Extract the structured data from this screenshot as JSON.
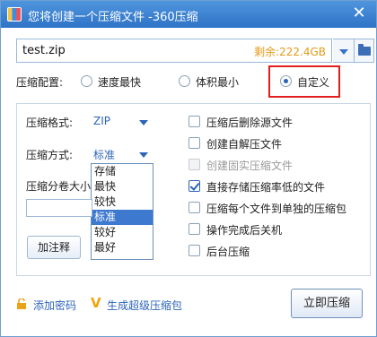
{
  "window": {
    "title": "您将创建一个压缩文件 -360压缩",
    "close_glyph": "✕"
  },
  "path": {
    "value": "test.zip",
    "free_space": "剩余:222.4GB"
  },
  "config": {
    "label": "压缩配置:",
    "options": [
      "速度最快",
      "体积最小",
      "自定义"
    ],
    "selected": "自定义"
  },
  "panel": {
    "format_label": "压缩格式:",
    "format_value": "ZIP",
    "method_label": "压缩方式:",
    "method_value": "标准",
    "method_options": [
      "存储",
      "最快",
      "较快",
      "标准",
      "较好",
      "最好"
    ],
    "split_label": "压缩分卷大小",
    "comment_button": "加注释",
    "checkboxes": [
      {
        "label": "压缩后删除源文件",
        "checked": false,
        "disabled": false
      },
      {
        "label": "创建自解压文件",
        "checked": false,
        "disabled": false
      },
      {
        "label": "创建固实压缩文件",
        "checked": false,
        "disabled": true
      },
      {
        "label": "直接存储压缩率低的文件",
        "checked": true,
        "disabled": false
      },
      {
        "label": "压缩每个文件到单独的压缩包",
        "checked": false,
        "disabled": false
      },
      {
        "label": "操作完成后关机",
        "checked": false,
        "disabled": false
      },
      {
        "label": "后台压缩",
        "checked": false,
        "disabled": false
      }
    ]
  },
  "footer": {
    "add_password": "添加密码",
    "super_package": "生成超级压缩包",
    "compress_now": "立即压缩"
  },
  "colors": {
    "accent": "#2d64b9",
    "warning": "#e39a16",
    "highlight": "#e02020"
  },
  "icons": [
    "app-logo-icon",
    "close-icon",
    "chevron-down-icon",
    "folder-icon",
    "lock-icon",
    "v-logo-icon"
  ]
}
